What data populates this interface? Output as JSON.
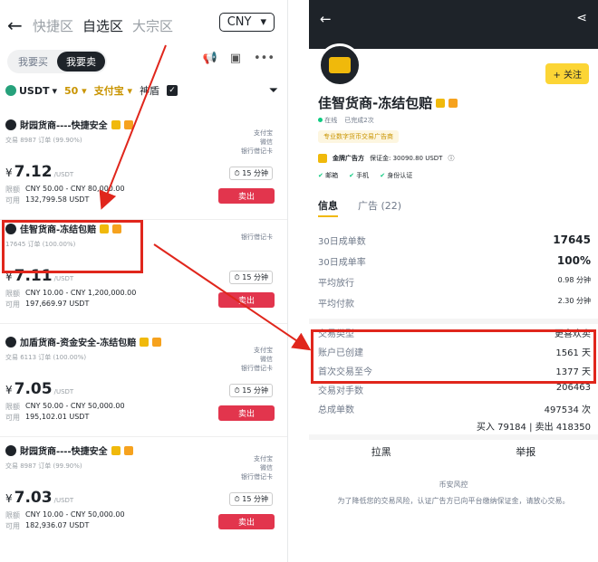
{
  "left": {
    "tabs": [
      "快捷区",
      "自选区",
      "大宗区"
    ],
    "active_tab": "自选区",
    "currency": "CNY",
    "segments": [
      "我要买",
      "我要卖"
    ],
    "filters": {
      "asset": "USDT",
      "amount": "50",
      "payment": "支付宝",
      "shield": "神盾"
    },
    "ads": [
      {
        "name": "財园货商----快捷安全",
        "stats": "交易 8987 订单 (99.90%)",
        "price": "7.12",
        "unit": "/USDT",
        "limit_label": "限额",
        "limit": "CNY 50.00 - CNY 80,000.00",
        "avail_label": "可用",
        "avail": "132,799.58 USDT",
        "payments": [
          "支付宝",
          "微信",
          "银行借记卡"
        ],
        "time": "15 分钟",
        "action": "卖出"
      },
      {
        "name": "佳智货商-冻结包赔",
        "stats": "17645 订单 (100.00%)",
        "price": "7.11",
        "unit": "/USDT",
        "limit_label": "限额",
        "limit": "CNY 10.00 - CNY 1,200,000.00",
        "avail_label": "可用",
        "avail": "197,669.97 USDT",
        "payments": [
          "银行借记卡"
        ],
        "time": "15 分钟",
        "action": "卖出"
      },
      {
        "name": "加盾货商-资金安全-冻结包赔",
        "stats": "交易 6113 订单 (100.00%)",
        "price": "7.05",
        "unit": "/USDT",
        "limit_label": "限额",
        "limit": "CNY 50.00 - CNY 50,000.00",
        "avail_label": "可用",
        "avail": "195,102.01 USDT",
        "payments": [
          "支付宝",
          "微信",
          "银行借记卡"
        ],
        "time": "15 分钟",
        "action": "卖出"
      },
      {
        "name": "財园货商----快捷安全",
        "stats": "交易 8987 订单 (99.90%)",
        "price": "7.03",
        "unit": "/USDT",
        "limit_label": "限额",
        "limit": "CNY 10.00 - CNY 50,000.00",
        "avail_label": "可用",
        "avail": "182,936.07 USDT",
        "payments": [
          "支付宝",
          "微信",
          "银行借记卡"
        ],
        "time": "15 分钟",
        "action": "卖出"
      }
    ]
  },
  "right": {
    "follow": "关注",
    "name": "佳智货商-冻结包赔",
    "online": "在线",
    "completed": "已完成2次",
    "tag": "专业数字货币交易广告商",
    "deposit_label": "金牌广告方",
    "deposit": "保证金: 30090.80 USDT",
    "checks": [
      "邮箱",
      "手机",
      "身份认证"
    ],
    "tabs": [
      "信息",
      "广告 (22)"
    ],
    "stats": [
      {
        "label": "30日成单数",
        "value": "17645"
      },
      {
        "label": "30日成单率",
        "value": "100%"
      },
      {
        "label": "平均放行",
        "value": "0.98 分钟"
      },
      {
        "label": "平均付款",
        "value": "2.30 分钟"
      }
    ],
    "stats2": [
      {
        "label": "交易类型",
        "value": "更喜欢卖"
      },
      {
        "label": "账户已创建",
        "value": "1561 天"
      },
      {
        "label": "首次交易至今",
        "value": "1377 天"
      },
      {
        "label": "交易对手数",
        "value": "206463"
      },
      {
        "label": "总成单数",
        "value": "497534 次"
      }
    ],
    "buy_sell": "买入 79184 | 卖出 418350",
    "actions": [
      "拉黑",
      "举报"
    ],
    "risk_title": "币安风控",
    "risk_desc": "为了降低您的交易风险，认证广告方已向平台缴纳保证金，请放心交易。"
  },
  "colors": {
    "sell": "#e2354d",
    "annotation": "#e0261c",
    "brand": "#f0b90b"
  }
}
